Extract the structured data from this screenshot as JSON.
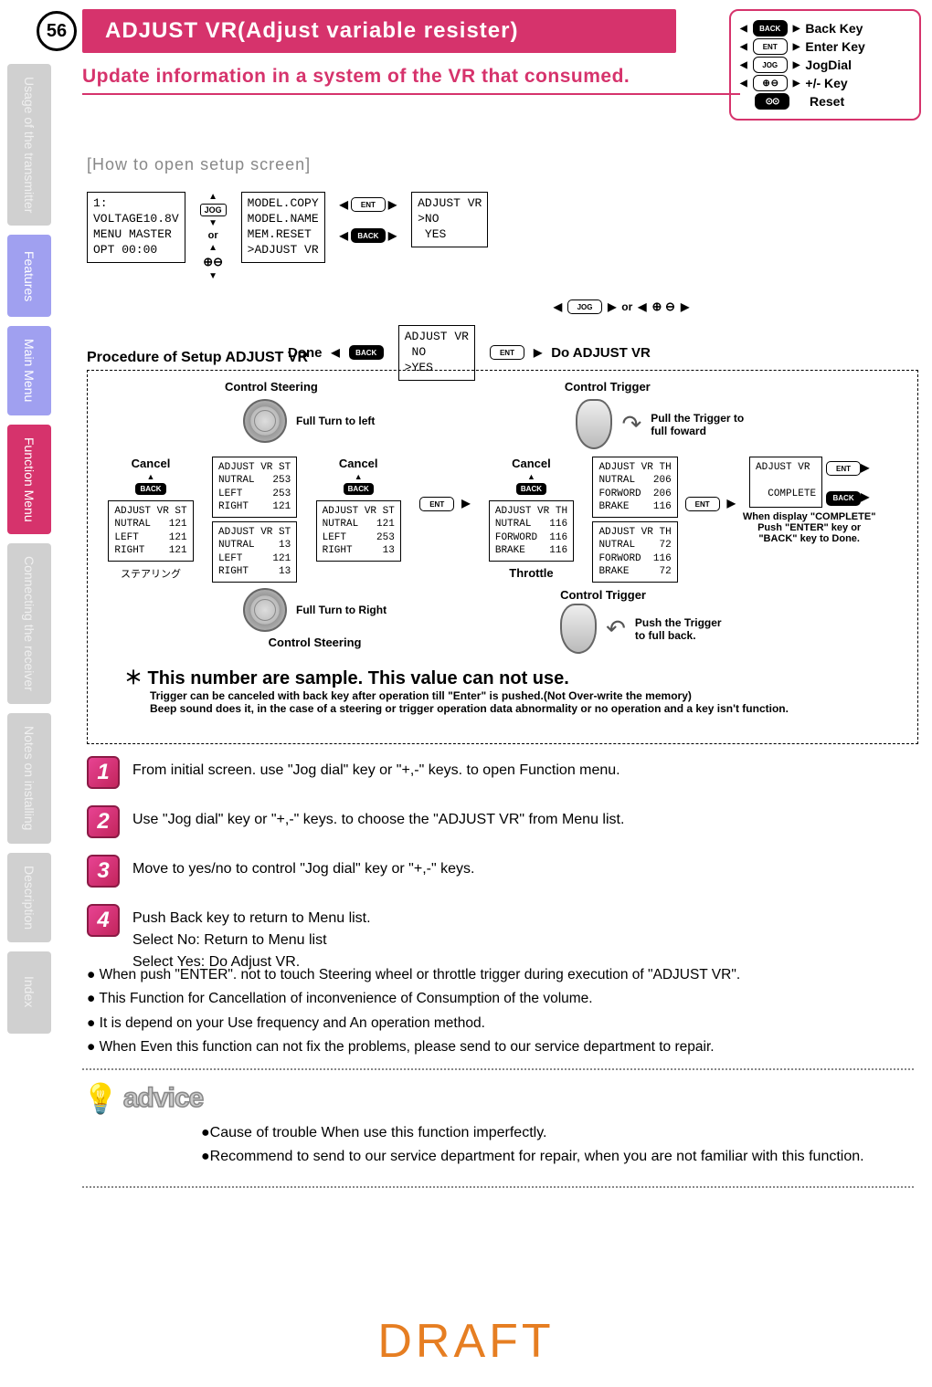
{
  "page_number": "56",
  "header_title": "ADJUST VR(Adjust variable resister)",
  "subtitle": "Update information in a system of the VR that consumed.",
  "key_legend": {
    "back": "Back Key",
    "enter": "Enter Key",
    "jog": "JogDial",
    "pm": "+/- Key",
    "reset": "Reset",
    "back_badge": "BACK",
    "ent_badge": "ENT",
    "jog_badge": "JOG",
    "pm_badge": "+ −",
    "reset_badge": "⊙⊙"
  },
  "side_tabs": [
    {
      "label": "Usage of the\ntransmitter",
      "active": false
    },
    {
      "label": "Features",
      "active": "light"
    },
    {
      "label": "Main Menu",
      "active": "light"
    },
    {
      "label": "Function Menu",
      "active": true
    },
    {
      "label": "Connecting\nthe receiver",
      "active": false
    },
    {
      "label": "Notes on\ninstalling",
      "active": false
    },
    {
      "label": "Description",
      "active": false
    },
    {
      "label": "Index",
      "active": false
    }
  ],
  "howto": "[How to open setup screen]",
  "flow": {
    "screen1": "1:\nVOLTAGE10.8V\nMENU MASTER\nOPT 00:00",
    "screen2": "MODEL.COPY\nMODEL.NAME\nMEM.RESET\n>ADJUST VR",
    "screen3": "ADJUST VR\n>NO\n YES",
    "screen4": "ADJUST VR\n NO\n>YES",
    "jog_label": "JOG",
    "or": "or",
    "ent_label": "ENT",
    "back_label": "BACK",
    "done": "Done",
    "do_adjust": "Do ADJUST VR",
    "jog_or_pm": "or"
  },
  "procedure_title": "Procedure of Setup ADJUST VR",
  "proc": {
    "control_steering": "Control Steering",
    "full_left": "Full Turn to left",
    "full_right": "Full Turn to Right",
    "control_trigger": "Control Trigger",
    "pull_foward": "Pull the Trigger to\nfull foward",
    "push_back": "Push the Trigger\nto full back.",
    "cancel": "Cancel",
    "throttle": "Throttle",
    "steering_jp": "ステアリング",
    "complete_note": "When display \"COMPLETE\"\nPush \"ENTER\" key or\n\"BACK\" key to Done.",
    "st_box1": "ADJUST VR ST\nNUTRAL   121\nLEFT     121\nRIGHT    121",
    "st_box2": "ADJUST VR ST\nNUTRAL   253\nLEFT     253\nRIGHT    121",
    "st_box3": "ADJUST VR ST\nNUTRAL    13\nLEFT     121\nRIGHT     13",
    "st_box4": "ADJUST VR ST\nNUTRAL   121\nLEFT     253\nRIGHT     13",
    "th_box1": "ADJUST VR TH\nNUTRAL   116\nFORWORD  116\nBRAKE    116",
    "th_box2": "ADJUST VR TH\nNUTRAL   206\nFORWORD  206\nBRAKE    116",
    "th_box3": "ADJUST VR TH\nNUTRAL    72\nFORWORD  116\nBRAKE     72",
    "complete_box": "ADJUST VR\n\n  COMPLETE",
    "star_note": "＊ This number are sample. This value can not use.",
    "star_sub1": "Trigger can be canceled with back key after operation till \"Enter\" is pushed.(Not Over-write the memory)",
    "star_sub2": "Beep sound does it, in the case of a steering or trigger operation data abnormality or no operation and a key isn't function."
  },
  "steps": [
    "From initial screen. use \"Jog dial\" key or \"+,-\" keys. to open Function menu.",
    "Use \"Jog dial\" key or \"+,-\" keys. to choose the \"ADJUST VR\" from Menu list.",
    "Move to yes/no to control \"Jog dial\" key or \"+,-\" keys.",
    "Push Back key to return to Menu list.\nSelect No: Return to Menu list\nSelect Yes: Do Adjust VR."
  ],
  "bullets": [
    "When push \"ENTER\". not to touch Steering wheel or throttle trigger during execution of \"ADJUST VR\".",
    "This Function for Cancellation of inconvenience of Consumption of the volume.",
    "It is depend on your Use frequency and An operation method.",
    "When Even this function can not fix the problems, please send to our service department to repair."
  ],
  "advice_label": "advice",
  "advice": [
    "Cause of trouble When use this function imperfectly.",
    "Recommend to send to our service department for repair, when you are not familiar with this function."
  ],
  "draft": "DRAFT"
}
